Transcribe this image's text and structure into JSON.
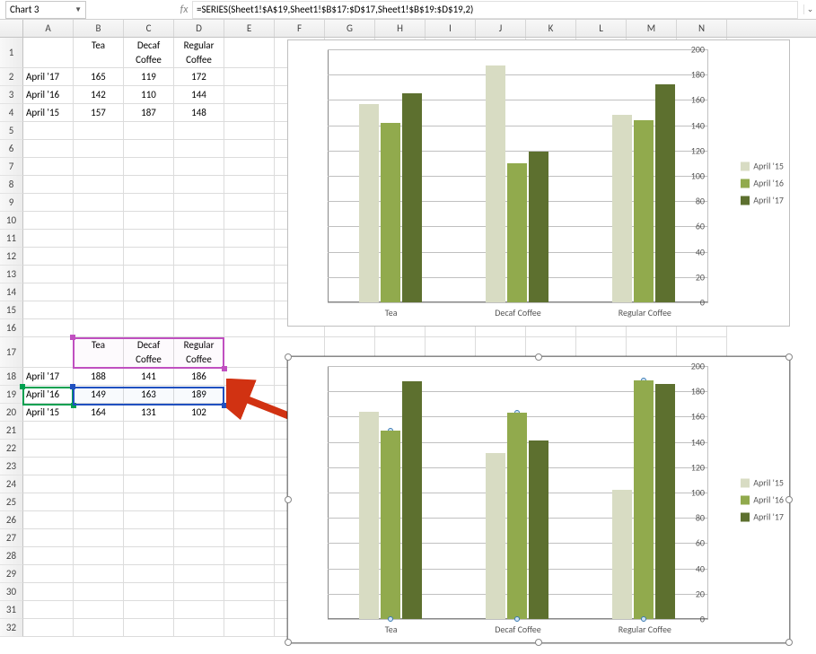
{
  "toolbar": {
    "namebox": "Chart 3",
    "formula": "=SERIES(Sheet1!$A$19,Sheet1!$B$17:$D$17,Sheet1!$B$19:$D$19,2)"
  },
  "columns": [
    "A",
    "B",
    "C",
    "D",
    "E",
    "F",
    "G",
    "H",
    "I",
    "J",
    "K",
    "L",
    "M",
    "N"
  ],
  "rows": [
    "1",
    "2",
    "3",
    "4",
    "5",
    "6",
    "7",
    "8",
    "9",
    "10",
    "11",
    "12",
    "13",
    "14",
    "15",
    "16",
    "17",
    "18",
    "19",
    "20",
    "21",
    "22",
    "23",
    "24",
    "25",
    "26",
    "27",
    "28",
    "29",
    "30",
    "31",
    "32"
  ],
  "table1": {
    "headers": [
      "",
      "Tea",
      "Decaf Coffee",
      "Regular Coffee"
    ],
    "rows": [
      {
        "label": "April '17",
        "vals": [
          "165",
          "119",
          "172"
        ]
      },
      {
        "label": "April '16",
        "vals": [
          "142",
          "110",
          "144"
        ]
      },
      {
        "label": "April '15",
        "vals": [
          "157",
          "187",
          "148"
        ]
      }
    ]
  },
  "table2": {
    "headers": [
      "",
      "Tea",
      "Decaf Coffee",
      "Regular Coffee"
    ],
    "rows": [
      {
        "label": "April '17",
        "vals": [
          "188",
          "141",
          "186"
        ]
      },
      {
        "label": "April '16",
        "vals": [
          "149",
          "163",
          "189"
        ]
      },
      {
        "label": "April '15",
        "vals": [
          "164",
          "131",
          "102"
        ]
      }
    ]
  },
  "chart_data": [
    {
      "type": "bar",
      "categories": [
        "Tea",
        "Decaf Coffee",
        "Regular Coffee"
      ],
      "series": [
        {
          "name": "April '15",
          "values": [
            157,
            187,
            148
          ]
        },
        {
          "name": "April '16",
          "values": [
            142,
            110,
            144
          ]
        },
        {
          "name": "April '17",
          "values": [
            165,
            119,
            172
          ]
        }
      ],
      "ylim": [
        0,
        200
      ],
      "ystep": 20,
      "xlabel": "",
      "ylabel": "",
      "title": ""
    },
    {
      "type": "bar",
      "categories": [
        "Tea",
        "Decaf Coffee",
        "Regular Coffee"
      ],
      "series": [
        {
          "name": "April '15",
          "values": [
            164,
            131,
            102
          ]
        },
        {
          "name": "April '16",
          "values": [
            149,
            163,
            189
          ]
        },
        {
          "name": "April '17",
          "values": [
            188,
            141,
            186
          ]
        }
      ],
      "ylim": [
        0,
        200
      ],
      "ystep": 20,
      "xlabel": "",
      "ylabel": "",
      "title": ""
    }
  ],
  "legend_labels": [
    "April '15",
    "April '16",
    "April '17"
  ]
}
